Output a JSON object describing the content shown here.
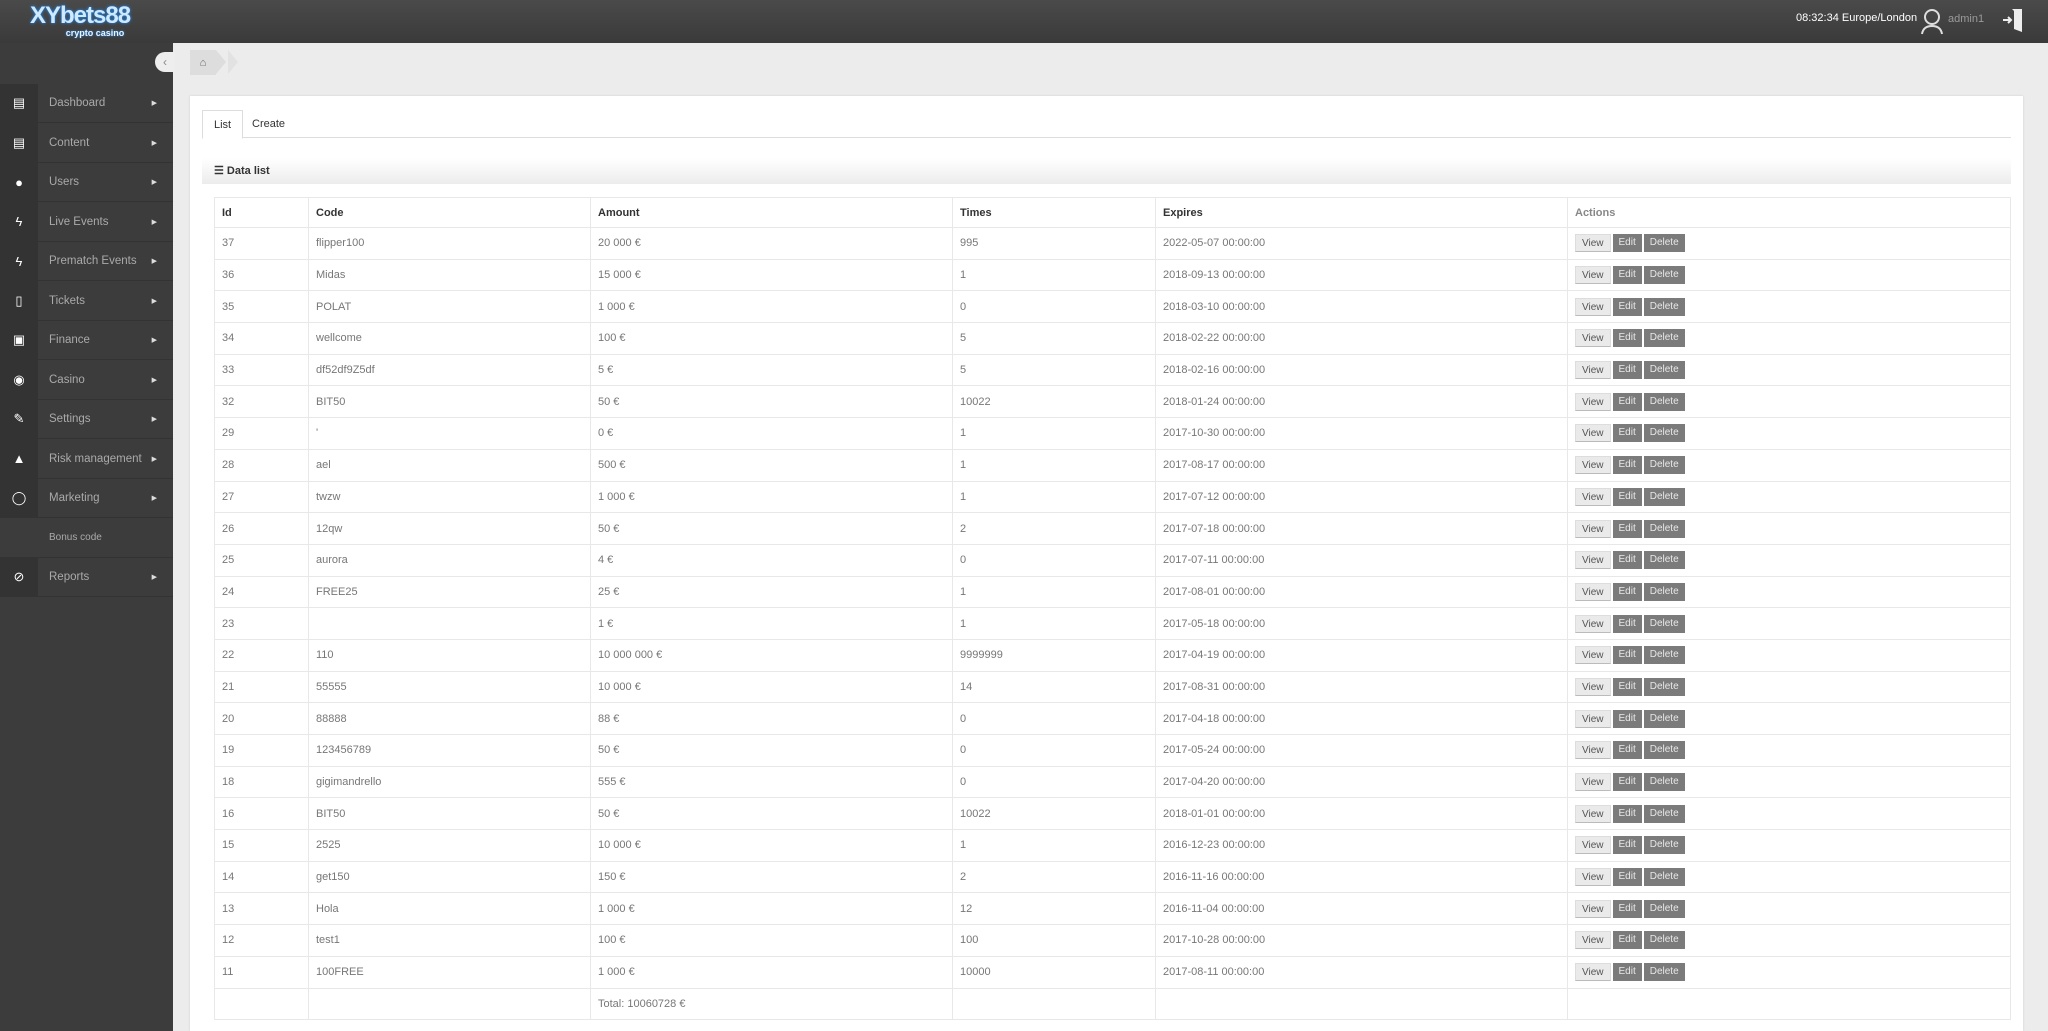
{
  "header": {
    "logo_main": "XYbets88",
    "logo_sub": "crypto casino",
    "clock": "08:32:34 Europe/London",
    "username": "admin1"
  },
  "sidebar": {
    "items": [
      {
        "label": "Dashboard",
        "icon": "book-icon",
        "glyph": "▤"
      },
      {
        "label": "Content",
        "icon": "book-icon",
        "glyph": "▤"
      },
      {
        "label": "Users",
        "icon": "user-icon",
        "glyph": "●"
      },
      {
        "label": "Live Events",
        "icon": "bolt-icon",
        "glyph": "ϟ"
      },
      {
        "label": "Prematch Events",
        "icon": "bolt-icon",
        "glyph": "ϟ"
      },
      {
        "label": "Tickets",
        "icon": "file-icon",
        "glyph": "▯"
      },
      {
        "label": "Finance",
        "icon": "money-icon",
        "glyph": "▣"
      },
      {
        "label": "Casino",
        "icon": "play-circle-icon",
        "glyph": "◉"
      },
      {
        "label": "Settings",
        "icon": "wrench-icon",
        "glyph": "✎"
      },
      {
        "label": "Risk management",
        "icon": "fire-extinguisher-icon",
        "glyph": "▲"
      },
      {
        "label": "Marketing",
        "icon": "comment-icon",
        "glyph": "◯"
      },
      {
        "label": "Bonus code",
        "icon": "",
        "glyph": ""
      },
      {
        "label": "Reports",
        "icon": "paperclip-icon",
        "glyph": "⊘"
      }
    ]
  },
  "tabs": {
    "list": "List",
    "create": "Create"
  },
  "section": {
    "title": "Data list"
  },
  "table": {
    "headers": [
      "Id",
      "Code",
      "Amount",
      "Times",
      "Expires",
      "Actions"
    ],
    "actions": {
      "view": "View",
      "edit": "Edit",
      "delete": "Delete"
    },
    "rows": [
      [
        "37",
        "flipper100",
        "20 000 €",
        "995",
        "2022-05-07 00:00:00"
      ],
      [
        "36",
        "Midas",
        "15 000 €",
        "1",
        "2018-09-13 00:00:00"
      ],
      [
        "35",
        "POLAT",
        "1 000 €",
        "0",
        "2018-03-10 00:00:00"
      ],
      [
        "34",
        "wellcome",
        "100 €",
        "5",
        "2018-02-22 00:00:00"
      ],
      [
        "33",
        "df52df9Z5df",
        "5 €",
        "5",
        "2018-02-16 00:00:00"
      ],
      [
        "32",
        "BIT50",
        "50 €",
        "10022",
        "2018-01-24 00:00:00"
      ],
      [
        "29",
        "'",
        "0 €",
        "1",
        "2017-10-30 00:00:00"
      ],
      [
        "28",
        "ael",
        "500 €",
        "1",
        "2017-08-17 00:00:00"
      ],
      [
        "27",
        "twzw",
        "1 000 €",
        "1",
        "2017-07-12 00:00:00"
      ],
      [
        "26",
        "12qw",
        "50 €",
        "2",
        "2017-07-18 00:00:00"
      ],
      [
        "25",
        "aurora",
        "4 €",
        "0",
        "2017-07-11 00:00:00"
      ],
      [
        "24",
        "FREE25",
        "25 €",
        "1",
        "2017-08-01 00:00:00"
      ],
      [
        "23",
        "",
        "1 €",
        "1",
        "2017-05-18 00:00:00"
      ],
      [
        "22",
        "110",
        "10 000 000 €",
        "9999999",
        "2017-04-19 00:00:00"
      ],
      [
        "21",
        "55555",
        "10 000 €",
        "14",
        "2017-08-31 00:00:00"
      ],
      [
        "20",
        "88888",
        "88 €",
        "0",
        "2017-04-18 00:00:00"
      ],
      [
        "19",
        "123456789",
        "50 €",
        "0",
        "2017-05-24 00:00:00"
      ],
      [
        "18",
        "gigimandrello",
        "555 €",
        "0",
        "2017-04-20 00:00:00"
      ],
      [
        "16",
        "BIT50",
        "50 €",
        "10022",
        "2018-01-01 00:00:00"
      ],
      [
        "15",
        "2525",
        "10 000 €",
        "1",
        "2016-12-23 00:00:00"
      ],
      [
        "14",
        "get150",
        "150 €",
        "2",
        "2016-11-16 00:00:00"
      ],
      [
        "13",
        "Hola",
        "1 000 €",
        "12",
        "2016-11-04 00:00:00"
      ],
      [
        "12",
        "test1",
        "100 €",
        "100",
        "2017-10-28 00:00:00"
      ],
      [
        "11",
        "100FREE",
        "1 000 €",
        "10000",
        "2017-08-11 00:00:00"
      ]
    ],
    "total": "Total: 10060728 €"
  }
}
